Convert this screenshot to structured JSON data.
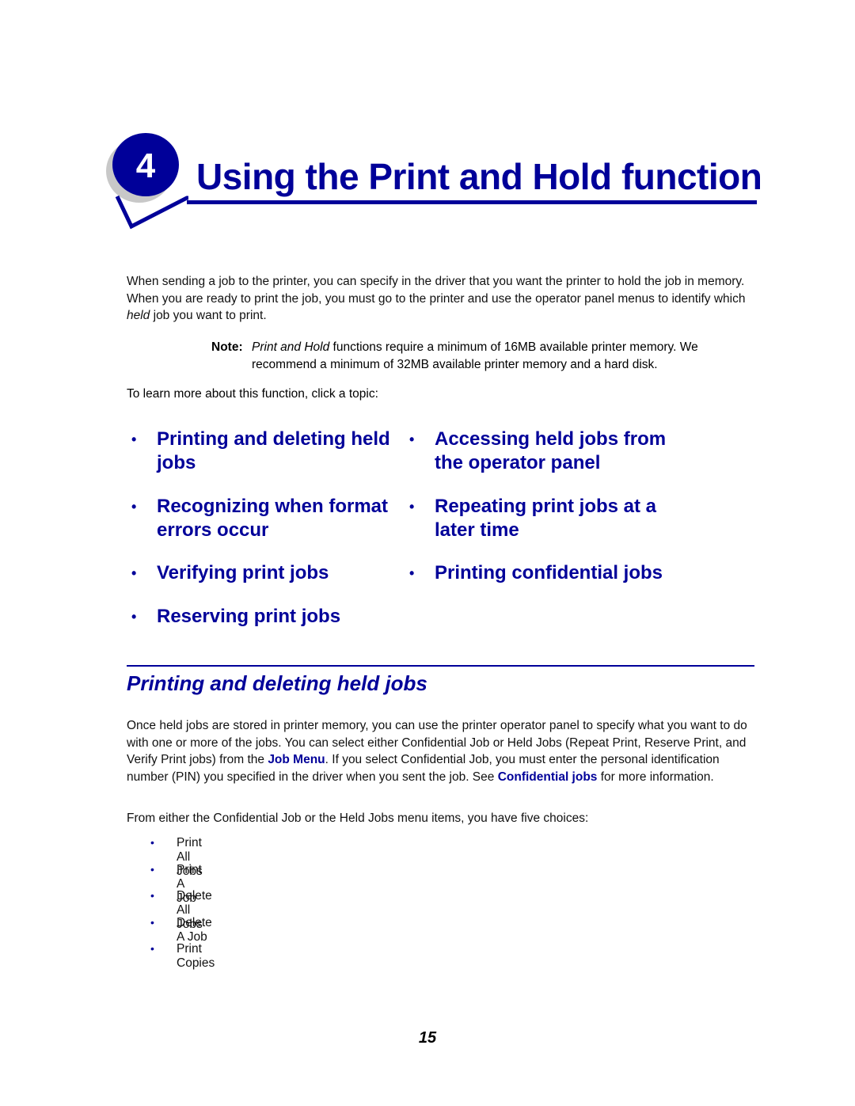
{
  "chapter": {
    "number": "4",
    "title": "Using the Print and Hold function"
  },
  "intro": {
    "p1_before": "When sending a job to the printer, you can specify in the driver that you want the printer to hold the job in memory. When you are ready to print the job, you must go to the printer and use the operator panel menus to identify which ",
    "p1_italic": "held",
    "p1_after": " job you want to print."
  },
  "note": {
    "label": "Note:",
    "italic": "Print and Hold",
    "text": " functions require a minimum of 16MB available printer memory. We recommend a minimum of 32MB available printer memory and a hard disk."
  },
  "topic_intro": "To learn more about this function, click a topic:",
  "topics": [
    {
      "bullet": "•",
      "label": "Printing and deleting held jobs"
    },
    {
      "bullet": "•",
      "label": "Accessing held jobs from the operator panel"
    },
    {
      "bullet": "•",
      "label": "Recognizing when format errors occur"
    },
    {
      "bullet": "•",
      "label": "Repeating print jobs at a later time"
    },
    {
      "bullet": "•",
      "label": "Verifying print jobs"
    },
    {
      "bullet": "•",
      "label": "Printing confidential jobs"
    },
    {
      "bullet": "•",
      "label": "Reserving print jobs"
    }
  ],
  "section": {
    "title": "Printing and deleting held jobs",
    "p1_a": "Once held jobs are stored in printer memory, you can use the printer operator panel to specify what you want to do with one or more of the jobs. You can select either Confidential Job or Held Jobs (Repeat Print, Reserve Print, and Verify Print jobs) from the ",
    "p1_link1": "Job Menu",
    "p1_b": ". If you select Confidential Job, you must enter the personal identification number (PIN) you specified in the driver when you sent the job. See ",
    "p1_link2": "Confidential jobs",
    "p1_c": " for more information.",
    "p2": "From either the Confidential Job or the Held Jobs menu items, you have five choices:",
    "choices": [
      "Print All Jobs",
      "Print A Job",
      "Delete All Jobs",
      "Delete A Job",
      "Print Copies"
    ]
  },
  "page_number": "15",
  "colors": {
    "accent": "#000099",
    "text": "#111111"
  }
}
